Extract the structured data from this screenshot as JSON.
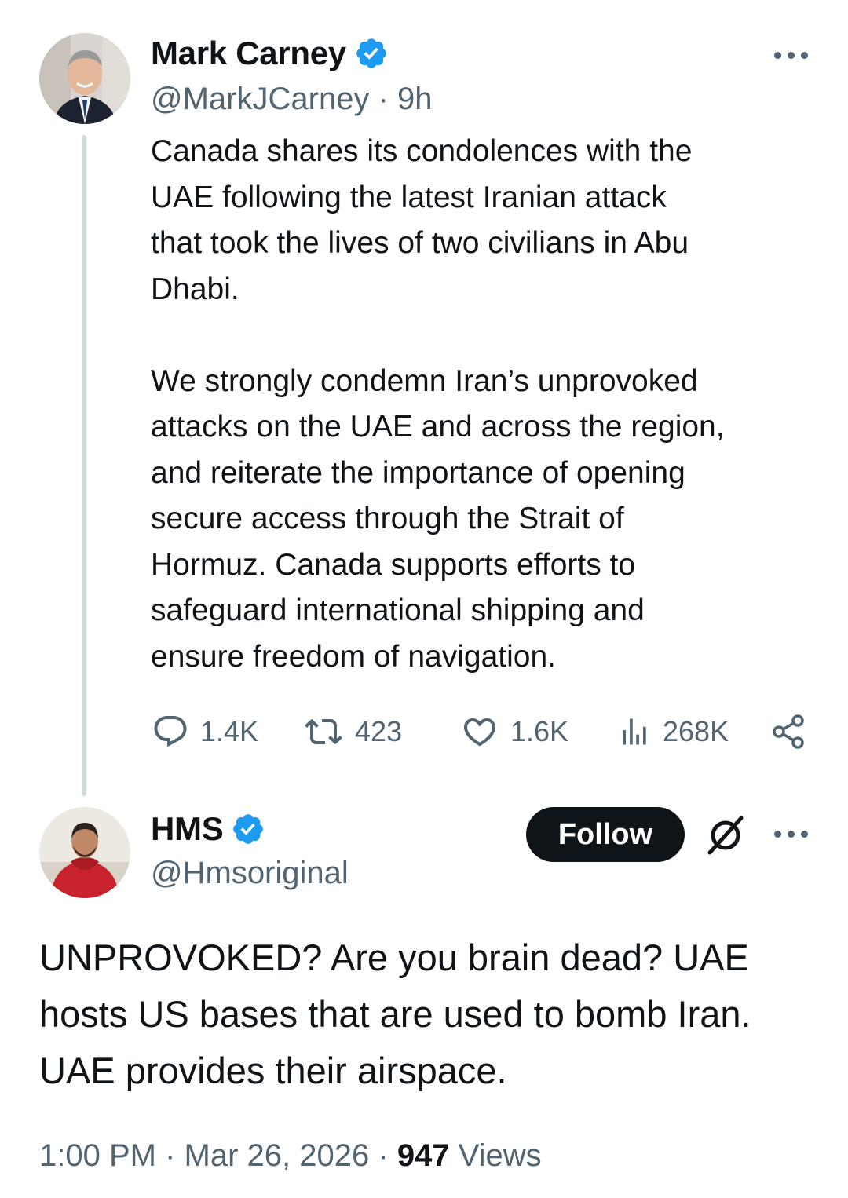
{
  "parent_tweet": {
    "author_name": "Mark Carney",
    "handle": "@MarkJCarney",
    "separator": "·",
    "time_ago": "9h",
    "text": "Canada shares its condolences with the\nUAE following the latest Iranian attack\nthat took the lives of two civilians in Abu\nDhabi.\n\nWe strongly condemn Iran’s unprovoked\nattacks on the UAE and across the region,\nand reiterate the importance of opening\nsecure access through the Strait of\nHormuz. Canada supports efforts to\nsafeguard international shipping and\nensure freedom of navigation.",
    "stats": {
      "replies": "1.4K",
      "reposts": "423",
      "likes": "1.6K",
      "views": "268K"
    }
  },
  "reply_tweet": {
    "author_name": "HMS",
    "handle": "@Hmsoriginal",
    "follow_label": "Follow",
    "text": "UNPROVOKED? Are you brain dead? UAE\nhosts US bases that are used to bomb Iran.\nUAE provides their airspace.",
    "time": "1:00 PM",
    "separator": "·",
    "date": "Mar 26, 2026",
    "views_count": "947",
    "views_label": "Views"
  },
  "colors": {
    "text": "#0f1419",
    "secondary": "#536471",
    "verified_blue": "#1d9bf0",
    "thread_line": "#cfd9de"
  },
  "icons": [
    "verified-badge-icon",
    "more-icon",
    "reply-icon",
    "repost-icon",
    "like-icon",
    "views-icon",
    "share-icon",
    "grok-icon"
  ]
}
